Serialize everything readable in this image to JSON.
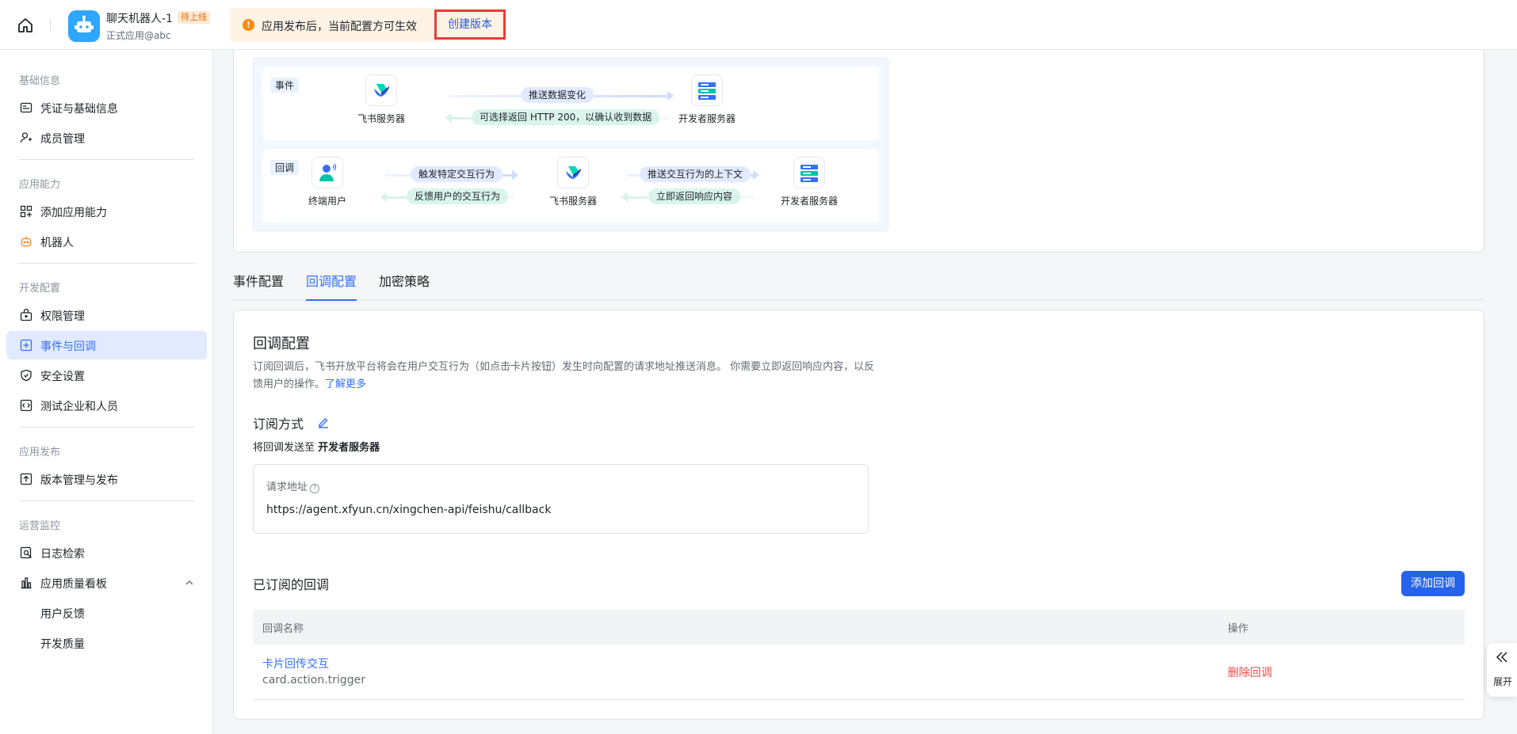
{
  "header": {
    "app_name": "聊天机器人-1",
    "app_badge": "待上线",
    "app_subtitle": "正式应用@abc",
    "notice_text": "应用发布后，当前配置方可生效",
    "create_version_label": "创建版本"
  },
  "sidebar": {
    "groups": {
      "basic": "基础信息",
      "capability": "应用能力",
      "dev": "开发配置",
      "publish": "应用发布",
      "monitor": "运营监控"
    },
    "items": {
      "credentials": "凭证与基础信息",
      "members": "成员管理",
      "add_capability": "添加应用能力",
      "bot": "机器人",
      "permissions": "权限管理",
      "events_callbacks": "事件与回调",
      "security": "安全设置",
      "test_enterprise": "测试企业和人员",
      "version_mgmt": "版本管理与发布",
      "log_search": "日志检索",
      "quality_board": "应用质量看板",
      "user_feedback": "用户反馈",
      "dev_quality": "开发质量"
    },
    "active": "events_callbacks"
  },
  "flow": {
    "event": {
      "tag": "事件",
      "node_feishu": "飞书服务器",
      "node_dev": "开发者服务器",
      "push_label": "推送数据变化",
      "return_label": "可选择返回 HTTP 200，以确认收到数据"
    },
    "callback": {
      "tag": "回调",
      "node_user": "终端用户",
      "node_feishu": "飞书服务器",
      "node_dev": "开发者服务器",
      "trigger_label": "触发特定交互行为",
      "feedback_label": "反馈用户的交互行为",
      "push_label": "推送交互行为的上下文",
      "respond_label": "立即返回响应内容"
    }
  },
  "tabs": {
    "event_config": "事件配置",
    "callback_config": "回调配置",
    "encryption": "加密策略",
    "active": "callback_config"
  },
  "callback_config": {
    "title": "回调配置",
    "description": "订阅回调后，飞书开放平台将会在用户交互行为（如点击卡片按钮）发生时向配置的请求地址推送消息。 你需要立即返回响应内容，以反馈用户的操作。",
    "learn_more": "了解更多",
    "subscribe_method_title": "订阅方式",
    "send_to_prefix": "将回调发送至",
    "send_to_target": "开发者服务器",
    "request_url_label": "请求地址",
    "request_url_value": "https://agent.xfyun.cn/xingchen-api/feishu/callback",
    "subscribed_title": "已订阅的回调",
    "add_callback_label": "添加回调",
    "table": {
      "col_name": "回调名称",
      "col_action": "操作",
      "rows": [
        {
          "name": "卡片回传交互",
          "event": "card.action.trigger",
          "action": "删除回调"
        }
      ]
    }
  },
  "expand_widget": {
    "label": "展开"
  },
  "colors": {
    "primary": "#3370ff",
    "button_primary": "#2463eb",
    "danger": "#f54a45",
    "highlight_border": "#e93c3c",
    "notice_bg": "#fff3e5"
  }
}
